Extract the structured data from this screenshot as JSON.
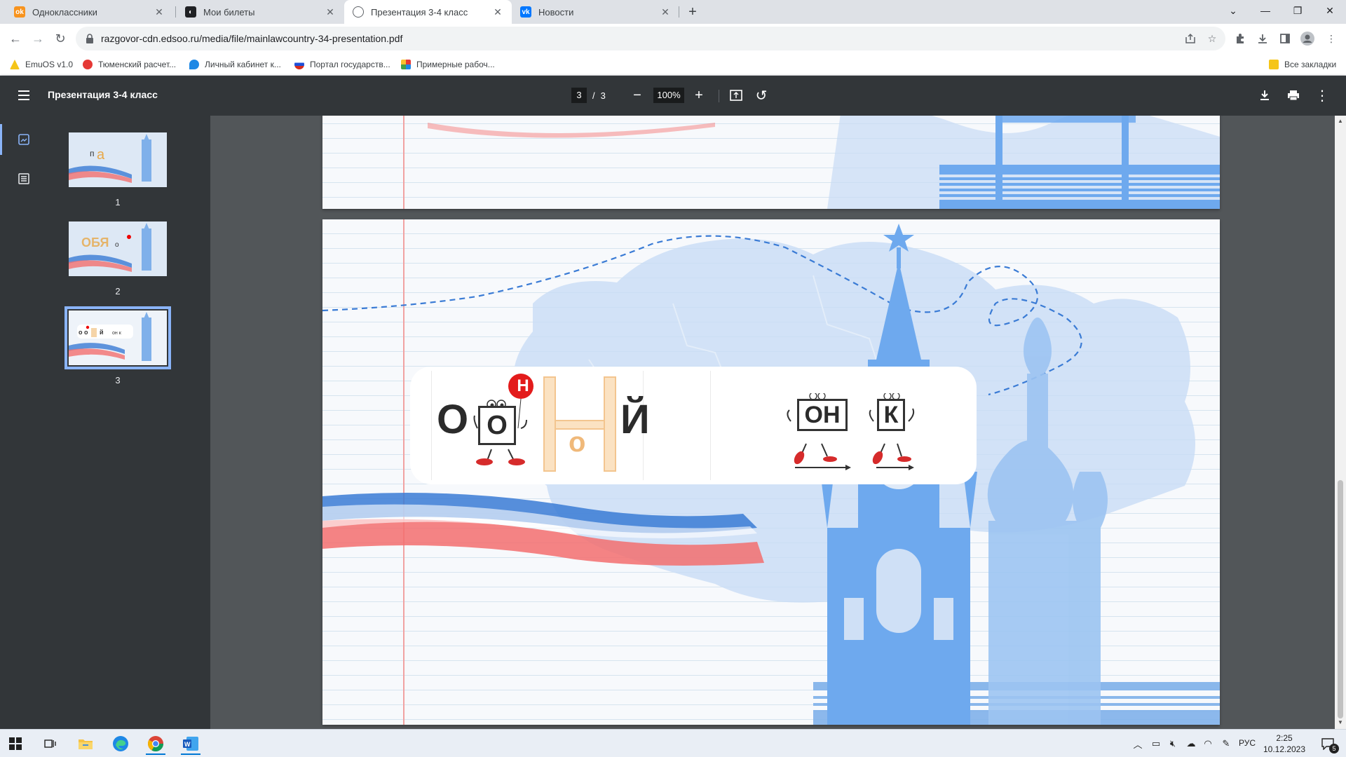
{
  "browser": {
    "tabs": [
      {
        "title": "Одноклассники",
        "icon": "ok-icon",
        "color": "#f7931e"
      },
      {
        "title": "Мои билеты",
        "icon": "globe-icon",
        "color": "#202124"
      },
      {
        "title": "Презентация 3-4 класс",
        "icon": "globe-icon",
        "color": "#5f6368",
        "active": true
      },
      {
        "title": "Новости",
        "icon": "vk-icon",
        "color": "#0077ff"
      }
    ],
    "url": "razgovor-cdn.edsoo.ru/media/file/mainlawcountry-34-presentation.pdf",
    "bookmarks": [
      {
        "label": "EmuOS v1.0",
        "color": "#f5c518"
      },
      {
        "label": "Тюменский расчет...",
        "color": "#e53935"
      },
      {
        "label": "Личный кабинет к...",
        "color": "#1e88e5"
      },
      {
        "label": "Портал государств...",
        "color": "#d32f2f"
      },
      {
        "label": "Примерные рабоч...",
        "color": "#7b1fa2"
      }
    ],
    "all_bookmarks": "Все закладки"
  },
  "pdf": {
    "title": "Презентация 3-4 класс",
    "current_page": "3",
    "page_sep": "/",
    "total_pages": "3",
    "zoom": "100%",
    "thumbnails": [
      {
        "num": "1"
      },
      {
        "num": "2"
      },
      {
        "num": "3",
        "selected": true
      }
    ],
    "slide": {
      "letter_o": "О",
      "box_o": "О",
      "badge_n": "Н",
      "big_n": "Н",
      "small_o": "о",
      "letter_y": "Й",
      "box_on": "ОН",
      "box_k": "К"
    }
  },
  "taskbar": {
    "language": "РУС",
    "time": "2:25",
    "date": "10.12.2023",
    "notifications": "5"
  },
  "colors": {
    "accent": "#8ab4f8",
    "toolbar_dark": "#323639",
    "flag_blue": "#3a7bd5",
    "flag_red": "#f36f6f",
    "kremlin": "#6ea9ee"
  }
}
